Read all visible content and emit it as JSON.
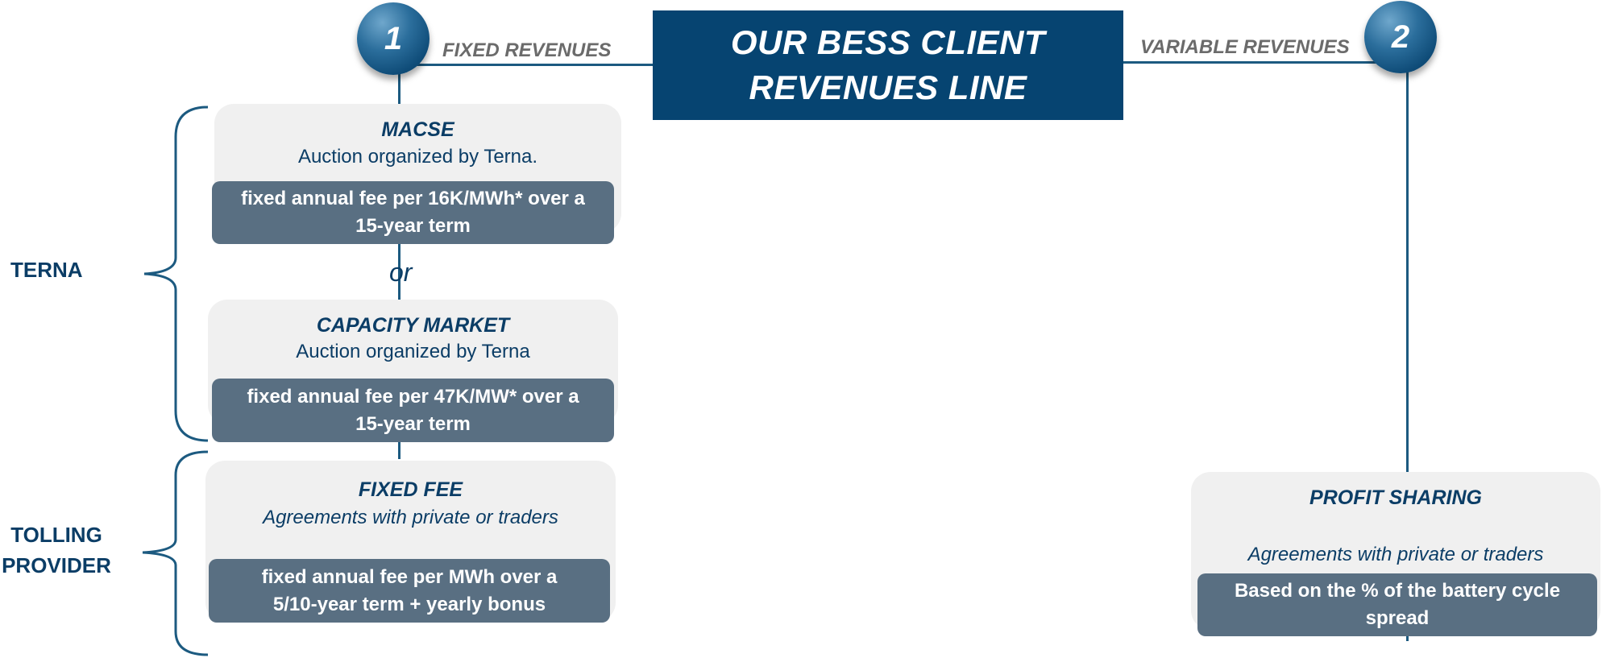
{
  "title": {
    "line1": "OUR BESS CLIENT",
    "line2": "REVENUES LINE"
  },
  "branches": {
    "fixed": {
      "number": "1",
      "label": "FIXED REVENUES"
    },
    "variable": {
      "number": "2",
      "label": "VARIABLE REVENUES"
    }
  },
  "groups": {
    "terna": "TERNA",
    "tolling_line1": "TOLLING",
    "tolling_line2": "PROVIDER"
  },
  "cards": {
    "macse": {
      "title": "MACSE",
      "subtitle": "Auction organized by Terna.",
      "fee_line1": "fixed annual fee per 16K/MWh* over a",
      "fee_line2": "15-year term"
    },
    "or_text": "or",
    "capacity": {
      "title": "CAPACITY MARKET",
      "subtitle": "Auction organized by Terna",
      "fee_line1": "fixed annual fee per 47K/MW* over a",
      "fee_line2": "15-year term"
    },
    "fixed_fee": {
      "title": "FIXED FEE",
      "subtitle": "Agreements with private or traders",
      "fee_line1": "fixed annual fee per MWh over a",
      "fee_line2": "5/10-year term + yearly bonus"
    },
    "profit_sharing": {
      "title": "PROFIT SHARING",
      "subtitle": "Agreements with private or traders",
      "fee_line1": "Based on the % of the battery cycle",
      "fee_line2": "spread"
    }
  },
  "colors": {
    "title_bg": "#064471",
    "connector": "#1c5a80",
    "card_bg": "#f0f0f0",
    "fee_bg": "#596f82",
    "text_dark_blue": "#0b3d66",
    "label_gray": "#6b6b6b"
  }
}
